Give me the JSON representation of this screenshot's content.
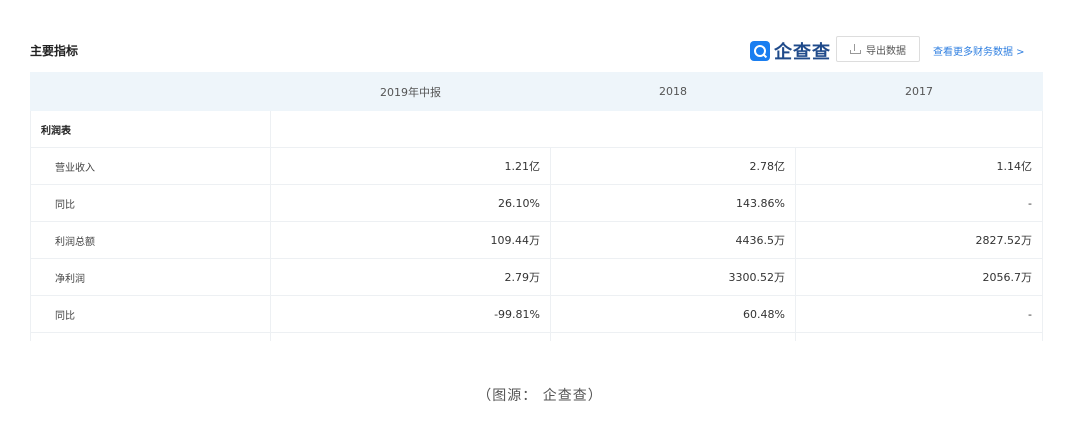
{
  "header": {
    "title": "主要指标",
    "brand": "企查查",
    "export_label": "导出数据",
    "more_link": "查看更多财务数据 >"
  },
  "table": {
    "columns": [
      "",
      "2019年中报",
      "2018",
      "2017"
    ],
    "section": "利润表",
    "rows": [
      {
        "label": "营业收入",
        "values": [
          "1.21亿",
          "2.78亿",
          "1.14亿"
        ]
      },
      {
        "label": "同比",
        "values": [
          "26.10%",
          "143.86%",
          "-"
        ]
      },
      {
        "label": "利润总额",
        "values": [
          "109.44万",
          "4436.5万",
          "2827.52万"
        ]
      },
      {
        "label": "净利润",
        "values": [
          "2.79万",
          "3300.52万",
          "2056.7万"
        ]
      },
      {
        "label": "同比",
        "values": [
          "-99.81%",
          "60.48%",
          "-"
        ]
      }
    ]
  },
  "caption": "（图源：  企查查）"
}
